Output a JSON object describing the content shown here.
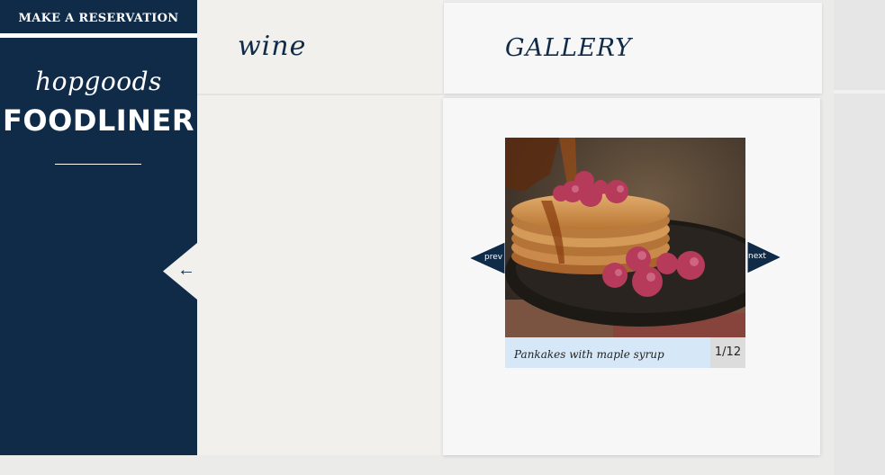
{
  "sidebar": {
    "reserve_label": "MAKE A RESERVATION",
    "brand_script": "hopgoods",
    "brand_main": "FOODLINER",
    "back_arrow": "←"
  },
  "wine": {
    "title": "wine"
  },
  "gallery": {
    "title": "GALLERY",
    "prev_label": "prev",
    "next_label": "next",
    "caption": "Pankakes with maple syrup",
    "counter": "1/12"
  },
  "colors": {
    "navy": "#0f2b48",
    "panel": "#f7f7f7",
    "wine_bg": "#f1f0ec",
    "caption_bg": "#d6e8f8"
  }
}
